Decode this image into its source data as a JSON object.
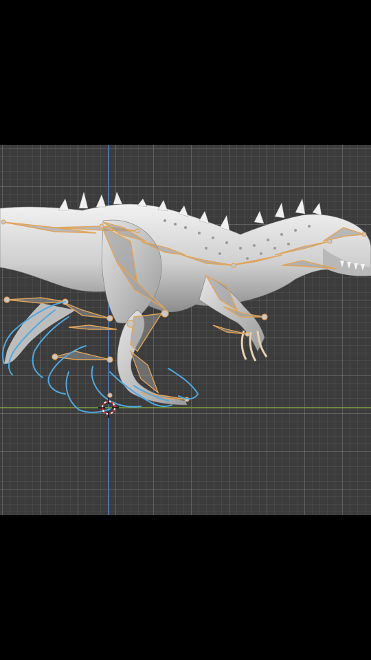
{
  "viewport": {
    "background": "#3c3c3c",
    "axis_x_color": "#7fa43a",
    "axis_z_color": "#4f7fc4"
  },
  "model": {
    "body_color": "#d8d8d8",
    "shadow_color": "#8a8a8a",
    "bone_color": "#e2a45a",
    "bone_fill": "#9a9a9a",
    "stroke_color": "#4fa9e0"
  },
  "icons": {
    "cursor": "3d-cursor-icon"
  }
}
